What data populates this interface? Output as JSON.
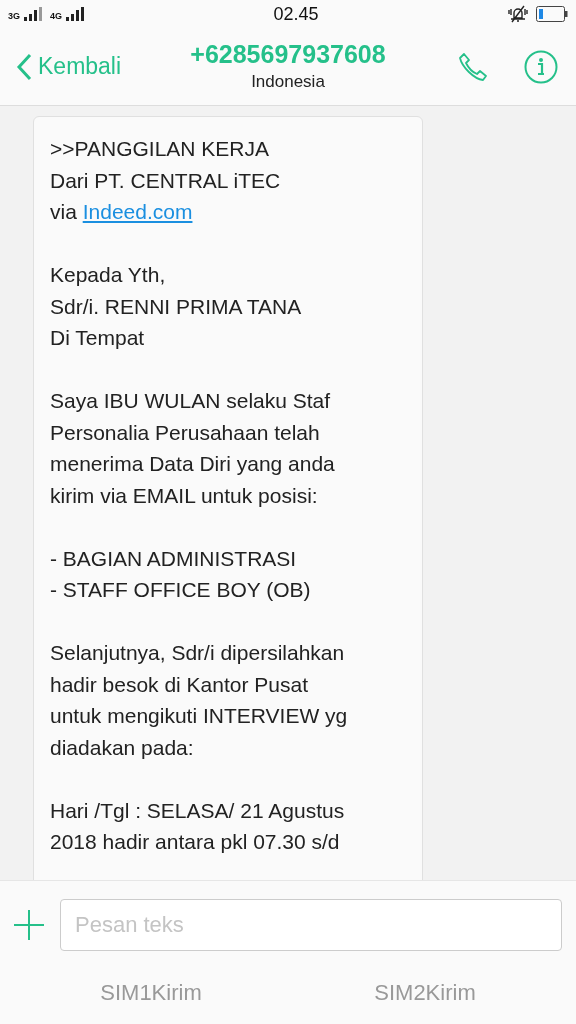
{
  "status_bar": {
    "network_1": "3G",
    "network_2": "4G",
    "time": "02.45"
  },
  "header": {
    "back_label": "Kembali",
    "title": "+6285697937608",
    "subtitle": "Indonesia"
  },
  "message": {
    "paragraphs": [
      {
        "text": ">>PANGGILAN KERJA\nDari PT. CENTRAL iTEC\nvia",
        "link": "Indeed.com"
      },
      {
        "text": "Kepada Yth,\nSdr/i. RENNI PRIMA TANA\nDi Tempat"
      },
      {
        "text": "Saya IBU WULAN selaku Staf\nPersonalia Perusahaan telah\nmenerima Data Diri yang anda\nkirim via EMAIL untuk posisi:"
      },
      {
        "text": "- BAGIAN ADMINISTRASI\n- STAFF OFFICE BOY (OB)"
      },
      {
        "text": "Selanjutnya, Sdr/i dipersilahkan\nhadir besok di Kantor Pusat\nuntuk mengikuti INTERVIEW yg\ndiadakan pada:"
      },
      {
        "text": "Hari /Tgl : SELASA/ 21 Agustus\n2018 hadir antara pkl 07.30 s/d"
      }
    ]
  },
  "composer": {
    "placeholder": "Pesan teks"
  },
  "send_buttons": [
    "SIM1Kirim",
    "SIM2Kirim"
  ]
}
